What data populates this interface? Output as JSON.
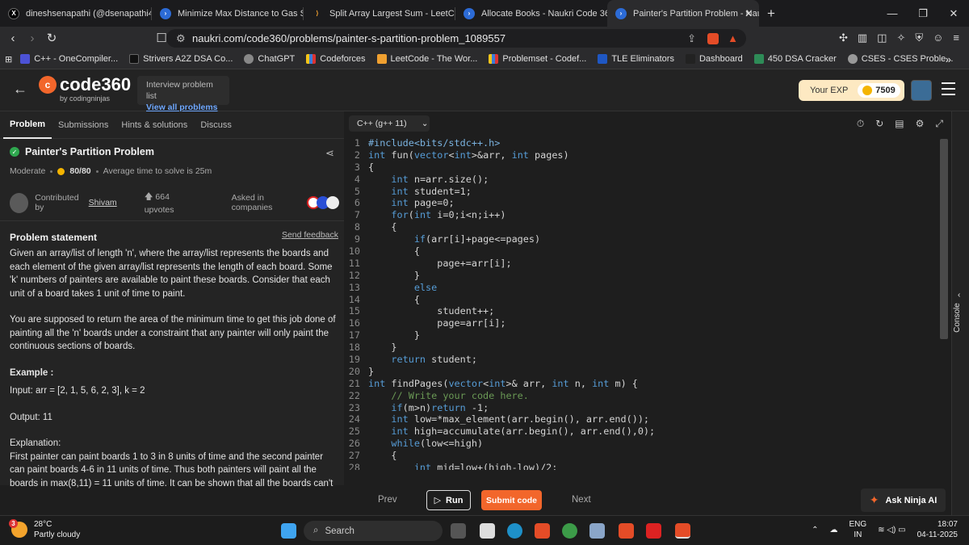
{
  "browser": {
    "tabs": [
      {
        "title": "dineshsenapathi (@dsenapathi4) / X",
        "icon": "x-logo-icon"
      },
      {
        "title": "Minimize Max Distance to Gas Station",
        "icon": "codingninjas-icon"
      },
      {
        "title": "Split Array Largest Sum - LeetCode",
        "icon": "leetcode-icon"
      },
      {
        "title": "Allocate Books - Naukri Code 360",
        "icon": "codingninjas-icon"
      },
      {
        "title": "Painter's Partition Problem - Nau",
        "icon": "codingninjas-icon"
      }
    ],
    "url_domain": "naukri.com",
    "url_path": "/code360/problems/painter-s-partition-problem_1089557",
    "bookmarks": [
      "C++ - OneCompiler...",
      "Strivers A2Z DSA Co...",
      "ChatGPT",
      "Codeforces",
      "LeetCode - The Wor...",
      "Problemset - Codef...",
      "TLE Eliminators",
      "Dashboard",
      "450 DSA Cracker",
      "CSES - CSES Proble..."
    ]
  },
  "header": {
    "logo": "code360",
    "logo_by": "by codingninjas",
    "interview_label": "Interview problem list",
    "view_all": "View all problems",
    "exp_label": "Your EXP",
    "exp_value": "7509"
  },
  "left": {
    "tabs": [
      "Problem",
      "Submissions",
      "Hints & solutions",
      "Discuss"
    ],
    "title": "Painter's Partition Problem",
    "difficulty": "Moderate",
    "score": "80/80",
    "avg_time": "Average time to solve is 25m",
    "contributed_by": "Contributed by",
    "contributor": "Shivam",
    "upvotes": "664 upvotes",
    "asked_in": "Asked in companies",
    "statement_heading": "Problem statement",
    "send_feedback": "Send feedback",
    "p1": "Given an array/list of length 'n', where the array/list represents the boards and each element of the given array/list represents the length of each board. Some 'k' numbers of painters are available to paint these boards. Consider that each unit of a board takes 1 unit of time to paint.",
    "p2": "You are supposed to return the area of the minimum time to get this job done of painting all the 'n' boards under a constraint that any painter will only paint the continuous sections of boards.",
    "example_heading": "Example :",
    "input": "Input: arr = [2, 1, 5, 6, 2, 3], k = 2",
    "output": "Output: 11",
    "explanation_heading": "Explanation:",
    "explanation": "First painter can paint boards 1 to 3 in 8 units of time and the second painter can paint boards 4-6 in 11 units of time. Thus both painters will paint all the boards in max(8,11) = 11 units of time. It can be shown that all the boards can't"
  },
  "editor": {
    "language": "C++ (g++ 11)",
    "lines": [
      "#include<bits/stdc++.h>",
      "int fun(vector<int>&arr, int pages)",
      "{",
      "    int n=arr.size();",
      "    int student=1;",
      "    int page=0;",
      "    for(int i=0;i<n;i++)",
      "    {",
      "        if(arr[i]+page<=pages)",
      "        {",
      "            page+=arr[i];",
      "        }",
      "        else",
      "        {",
      "            student++;",
      "            page=arr[i];",
      "        }",
      "    }",
      "    return student;",
      "}",
      "int findPages(vector<int>& arr, int n, int m) {",
      "    // Write your code here.",
      "    if(m>n)return -1;",
      "    int low=*max_element(arr.begin(), arr.end());",
      "    int high=accumulate(arr.begin(), arr.end(),0);",
      "    while(low<=high)",
      "    {",
      "        int mid=low+(high-low)/2;"
    ]
  },
  "footer": {
    "prev": "Prev",
    "run": "Run",
    "submit": "Submit code",
    "next": "Next",
    "ask_ninja": "Ask Ninja AI",
    "console": "Console"
  },
  "taskbar": {
    "temp": "28°C",
    "weather": "Partly cloudy",
    "search": "Search",
    "lang1": "ENG",
    "lang2": "IN",
    "time": "18:07",
    "date": "04-11-2025",
    "badge": "3"
  }
}
